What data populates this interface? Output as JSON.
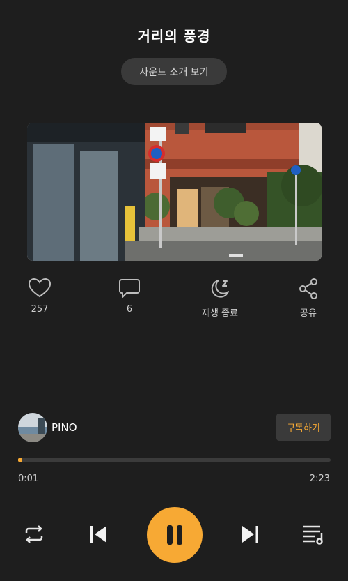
{
  "header": {
    "title": "거리의 풍경"
  },
  "intro_button": {
    "label": "사운드 소개 보기"
  },
  "actions": [
    {
      "icon": "heart-icon",
      "label": "257"
    },
    {
      "icon": "comment-icon",
      "label": "6"
    },
    {
      "icon": "sleep-timer-icon",
      "label": "재생 종료"
    },
    {
      "icon": "share-icon",
      "label": "공유"
    }
  ],
  "artist": {
    "name": "PINO",
    "subscribe_label": "구독하기"
  },
  "player": {
    "current_time": "0:01",
    "total_time": "2:23",
    "progress": 0.007
  },
  "colors": {
    "accent": "#f7a934",
    "background": "#1e1e1e",
    "button": "#3a3a3a"
  }
}
